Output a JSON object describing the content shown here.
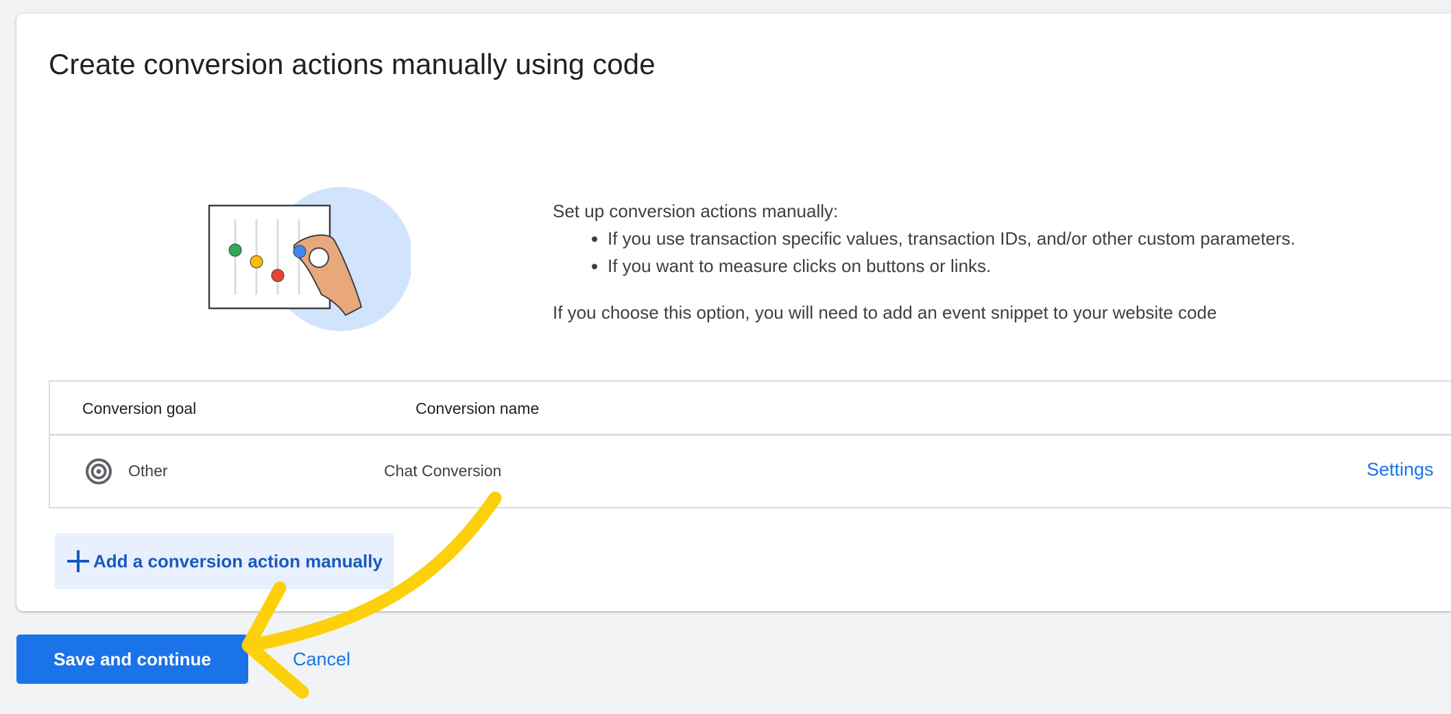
{
  "page": {
    "title": "Create conversion actions manually using code"
  },
  "description": {
    "intro": "Set up conversion actions manually:",
    "bullets": [
      "If you use transaction specific values, transaction IDs, and/or other custom parameters.",
      "If you want to measure clicks on buttons or links."
    ],
    "note": "If you choose this option, you will need to add an event snippet to your website code"
  },
  "table": {
    "headers": [
      "Conversion goal",
      "Conversion name"
    ],
    "rows": [
      {
        "goal_icon": "target-icon",
        "goal": "Other",
        "name": "Chat Conversion",
        "action": "Settings"
      }
    ]
  },
  "buttons": {
    "add_action": "Add a conversion action manually",
    "save": "Save and continue",
    "cancel": "Cancel"
  },
  "colors": {
    "primary": "#1a73e8",
    "add_button_bg": "#e8f0fe",
    "annotation_arrow": "#fcd00a",
    "page_bg": "#f1f3f4"
  },
  "illustration": {
    "icon": "sliders-hand-illustration",
    "dot_colors": [
      "#34a853",
      "#fbbc04",
      "#ea4335",
      "#4285f4"
    ]
  }
}
